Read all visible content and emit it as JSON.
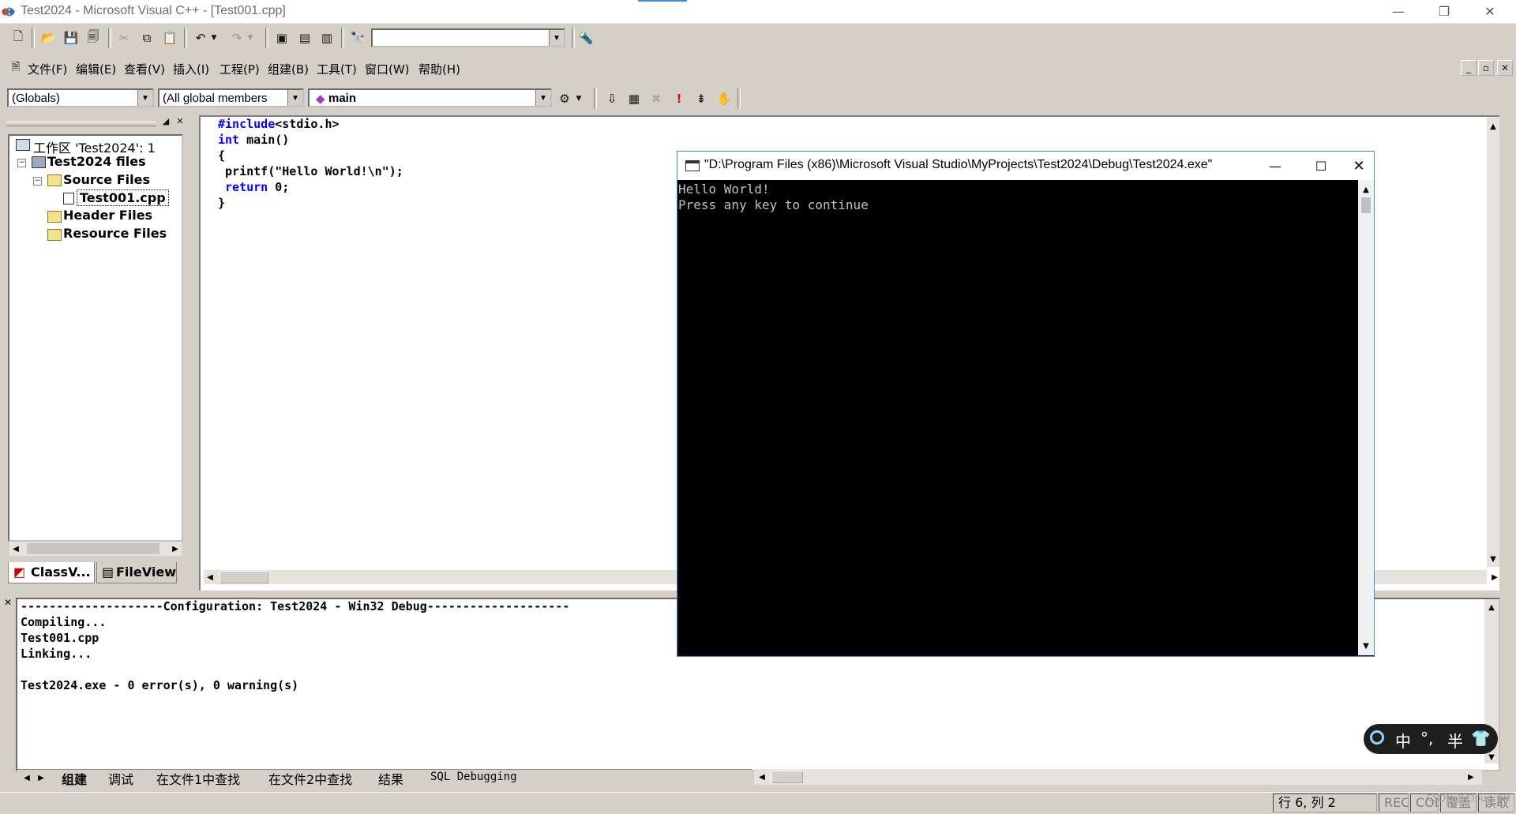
{
  "window": {
    "title": "Test2024 - Microsoft Visual C++ - [Test001.cpp]",
    "minimize": "—",
    "restore": "❐",
    "close": "✕"
  },
  "menu": {
    "items": [
      "文件(F)",
      "编辑(E)",
      "查看(V)",
      "插入(I)",
      "工程(P)",
      "组建(B)",
      "工具(T)",
      "窗口(W)",
      "帮助(H)"
    ],
    "mdi_min": "_",
    "mdi_restore": "▫",
    "mdi_close": "✕"
  },
  "toolbar": {
    "find_combo_value": "",
    "scope_combo": "(Globals)",
    "members_combo": "(All global members",
    "function_combo": "main"
  },
  "workspace": {
    "root": "工作区 'Test2024': 1",
    "project": "Test2024 files",
    "source_folder": "Source Files",
    "source_file": "Test001.cpp",
    "header_folder": "Header Files",
    "resource_folder": "Resource Files",
    "tabs": [
      "ClassV...",
      "FileView"
    ]
  },
  "editor": {
    "lines": [
      {
        "kw": "#include",
        "rest": "<stdio.h>"
      },
      {
        "kw": "int",
        "rest": " main()"
      },
      {
        "kw": "",
        "rest": "{"
      },
      {
        "kw": "",
        "rest": " printf(\"Hello World!\\n\");"
      },
      {
        "kw": " return",
        "rest": " 0;"
      },
      {
        "kw": "",
        "rest": "}"
      }
    ]
  },
  "console": {
    "title": "\"D:\\Program Files (x86)\\Microsoft Visual Studio\\MyProjects\\Test2024\\Debug\\Test2024.exe\"",
    "lines": [
      "Hello World!",
      "Press any key to continue"
    ]
  },
  "output": {
    "lines": [
      "--------------------Configuration: Test2024 - Win32 Debug--------------------",
      "Compiling...",
      "Test001.cpp",
      "Linking...",
      "",
      "Test2024.exe - 0 error(s), 0 warning(s)"
    ],
    "tabs": [
      "组建",
      "调试",
      "在文件1中查找",
      "在文件2中查找",
      "结果",
      "SQL Debugging"
    ]
  },
  "ime": {
    "lang": "中",
    "punct": "°,",
    "width": "半"
  },
  "status": {
    "position": "行 6, 列 2",
    "rec": "REC",
    "col": "COL",
    "ovr": "覆盖",
    "read": "读取",
    "watermark": "CSDN @Cloud_SH"
  },
  "colors": {
    "chrome": "#d4d0c8",
    "keyword": "#0000ff",
    "console_bg": "#000000",
    "console_text": "#c0c0c0"
  }
}
